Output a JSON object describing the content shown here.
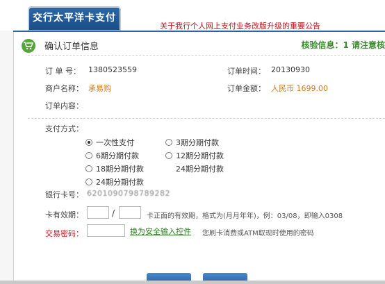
{
  "header": {
    "brand": "交行太平洋卡支付",
    "announcement": "关于我行个人网上支付业务改版升级的重要公告"
  },
  "section": {
    "title": "确认订单信息",
    "verify_text": "核验信息：1   请注意核"
  },
  "order": {
    "order_no_label": "订 单 号：",
    "order_no": "1380523559",
    "order_time_label": "订单时间：",
    "order_time": "20130930",
    "merchant_label": "商户名称：",
    "merchant": "承易购",
    "amount_label": "订单金额：",
    "amount": "人民币 1699.00",
    "content_label": "订单内容："
  },
  "payment": {
    "method_label": "支付方式：",
    "options": [
      {
        "label": "一次性支付",
        "selected": true
      },
      {
        "label": "3期分期付款",
        "selected": false
      },
      {
        "label": "6期分期付款",
        "selected": false
      },
      {
        "label": "12期分期付款",
        "selected": false
      },
      {
        "label": "18期分期付款",
        "selected": false
      },
      {
        "label": "24期分期付款",
        "selected": false
      },
      {
        "label": "24期分期付款",
        "selected": false
      }
    ],
    "card_no_label": "银行卡号：",
    "card_no": "6201090798789282",
    "expiry_label": "卡有效期：",
    "expiry_slash": "/",
    "expiry_hint": "卡正面的有效期，格式为(月月年年)，例：03/08，即输入0308",
    "password_label": "交易密码：",
    "secure_link": "换为安全输入控件",
    "password_hint": "您刷卡消费或ATM取现时使用的密码"
  },
  "colors": {
    "brand_blue": "#2b67a6",
    "announce_red": "#c7121e",
    "verify_green": "#3b8a2f",
    "amount_orange": "#d07a1a"
  }
}
